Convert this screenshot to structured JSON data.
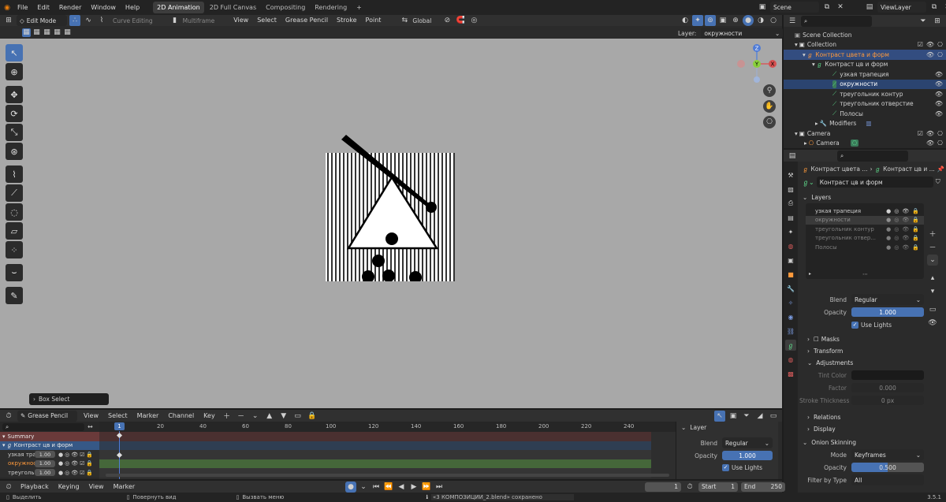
{
  "topbar": {
    "menus": [
      "File",
      "Edit",
      "Render",
      "Window",
      "Help"
    ],
    "workspaces": [
      "2D Animation",
      "2D Full Canvas",
      "Compositing",
      "Rendering"
    ],
    "active_workspace": 0,
    "add_tab": "+",
    "scene": "Scene",
    "view_layer": "ViewLayer"
  },
  "viewport_header": {
    "mode": "Edit Mode",
    "curve_editing": "Curve Editing",
    "multiframe": "Multiframe",
    "menus": [
      "View",
      "Select",
      "Grease Pencil",
      "Stroke",
      "Point"
    ],
    "transform_orientation": "Global",
    "layer_label": "Layer:",
    "layer_value": "окружности"
  },
  "viewport": {
    "box_select_label": "Box Select",
    "gizmo": {
      "z": "Z",
      "y": "Y",
      "x": "X"
    }
  },
  "outliner": {
    "search_placeholder": "",
    "rows": [
      {
        "label": "Scene Collection",
        "indent": 0,
        "state": ""
      },
      {
        "label": "Collection",
        "indent": 1,
        "state": ""
      },
      {
        "label": "Контраст цвета и форм",
        "indent": 2,
        "state": "selected"
      },
      {
        "label": "Контраст цв и форм",
        "indent": 3,
        "state": ""
      },
      {
        "label": "узкая трапеция",
        "indent": 4,
        "state": ""
      },
      {
        "label": "окружности",
        "indent": 4,
        "state": "active"
      },
      {
        "label": "треугольник контур",
        "indent": 4,
        "state": ""
      },
      {
        "label": "треугольник отверстие",
        "indent": 4,
        "state": ""
      },
      {
        "label": "Полосы",
        "indent": 4,
        "state": ""
      },
      {
        "label": "Modifiers",
        "indent": 3,
        "state": ""
      },
      {
        "label": "Camera",
        "indent": 1,
        "state": ""
      },
      {
        "label": "Camera",
        "indent": 2,
        "state": ""
      }
    ]
  },
  "properties": {
    "breadcrumb_obj": "Контраст цвета ...",
    "breadcrumb_data": "Контраст цв и ...",
    "datablock": "Контраст цв и форм",
    "layers_title": "Layers",
    "layers": [
      "узкая трапеция",
      "окружности",
      "треугольник контур",
      "треугольник отвер...",
      "Полосы"
    ],
    "active_layer_index": 1,
    "blend_label": "Blend",
    "blend_value": "Regular",
    "opacity_label": "Opacity",
    "opacity_value": "1.000",
    "use_lights": "Use Lights",
    "masks": "Masks",
    "transform": "Transform",
    "adjustments": "Adjustments",
    "tint_color": "Tint Color",
    "factor_label": "Factor",
    "factor_value": "0.000",
    "stroke_thickness": "Stroke Thickness",
    "stroke_thickness_value": "0 px",
    "relations": "Relations",
    "display": "Display",
    "onion_skinning": "Onion Skinning",
    "onion_mode_label": "Mode",
    "onion_mode_value": "Keyframes",
    "onion_opacity_label": "Opacity",
    "onion_opacity_value": "0.500",
    "filter_by_type_label": "Filter by Type",
    "filter_by_type_value": "All"
  },
  "dopesheet": {
    "editor": "Grease Pencil",
    "menus": [
      "View",
      "Select",
      "Marker",
      "Channel",
      "Key"
    ],
    "current_frame": "1",
    "ruler": [
      "20",
      "40",
      "60",
      "80",
      "100",
      "120",
      "140",
      "160",
      "180",
      "200",
      "220",
      "240"
    ],
    "summary": "Summary",
    "object": "Контраст цв и форм",
    "channels": [
      {
        "name": "узкая трап",
        "value": "1.00",
        "color": "#cfcfcf"
      },
      {
        "name": "окружнос",
        "value": "1.00",
        "color": "#ff9a3c"
      },
      {
        "name": "треугольн",
        "value": "1.00",
        "color": "#cfcfcf"
      }
    ],
    "side_panel_title": "Layer",
    "side_blend_label": "Blend",
    "side_blend_value": "Regular",
    "side_opacity_label": "Opacity",
    "side_opacity_value": "1.000",
    "side_use_lights": "Use Lights"
  },
  "timeline": {
    "menus": [
      "Playback",
      "Keying",
      "View",
      "Marker"
    ],
    "frame": "1",
    "start_label": "Start",
    "start_value": "1",
    "end_label": "End",
    "end_value": "250"
  },
  "statusbar": {
    "select": "Выделить",
    "rotate": "Повернуть вид",
    "menu": "Вызвать меню",
    "message": "«3 КОМПОЗИЦИИ_2.blend» сохранено",
    "version": "3.5.1"
  }
}
